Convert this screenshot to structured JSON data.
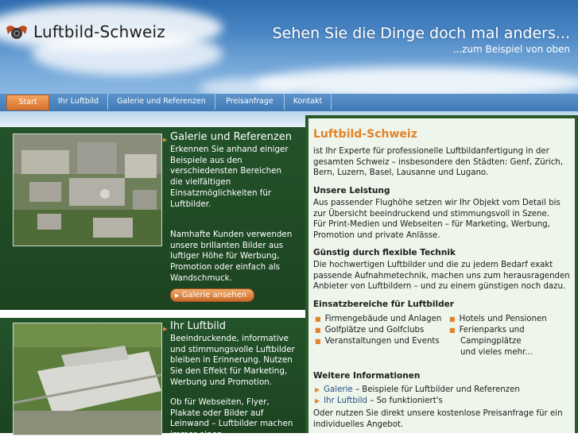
{
  "header": {
    "logo_text": "Luftbild-Schweiz",
    "slogan": "Sehen Sie die Dinge doch mal anders...",
    "subslogan": "...zum Beispiel von oben"
  },
  "nav": {
    "items": [
      {
        "label": "Start",
        "active": true
      },
      {
        "label": "Ihr Luftbild"
      },
      {
        "label": "Galerie und Referenzen"
      },
      {
        "label": "Preisanfrage"
      },
      {
        "label": "Kontakt"
      }
    ]
  },
  "promo_gallery": {
    "title": "Galerie und Referenzen",
    "text1": "Erkennen Sie anhand einiger Beispiele aus den verschiedensten Bereichen die vielfältigen Einsatzmöglichkeiten für Luftbilder.",
    "text2": "Namhafte Kunden verwenden unsere brillanten Bilder aus luftiger Höhe für Werbung, Promotion oder einfach als Wandschmuck.",
    "button": "Galerie ansehen"
  },
  "promo_luftbild": {
    "title": "Ihr Luftbild",
    "text1": "Beeindruckende, informative und stimmungsvolle Luftbilder bleiben in Erinnerung. Nutzen Sie den Effekt für Marketing, Werbung und Promotion.",
    "text2": "Ob für Webseiten, Flyer, Plakate oder Bilder auf Leinwand – Luftbilder machen immer einen"
  },
  "right": {
    "title": "Luftbild-Schweiz",
    "intro": "ist Ihr Experte für professionelle Luftbildanfertigung in der gesamten Schweiz – insbesondere den Städten: Genf, Zürich, Bern, Luzern, Basel, Lausanne und Lugano.",
    "h_leistung": "Unsere Leistung",
    "leistung": "Aus passender Flughöhe setzen wir Ihr Objekt vom Detail bis zur Übersicht beeindruckend und stimmungsvoll in Szene.",
    "leistung2": "Für Print-Medien und Webseiten – für Marketing, Werbung, Promotion und private Anlässe.",
    "h_technik": "Günstig durch flexible Technik",
    "technik": "Die hochwertigen Luftbilder und die zu jedem Bedarf exakt passende Aufnahmetechnik, machen uns zum herausragenden Anbieter von Luftbildern – und zu einem günstigen noch dazu.",
    "h_einsatz": "Einsatzbereiche für Luftbilder",
    "einsatz_left": [
      "Firmengebäude und Anlagen",
      "Golfplätze und Golfclubs",
      "Veranstaltungen und Events"
    ],
    "einsatz_right": [
      "Hotels und Pensionen",
      "Ferienparks und Campingplätze",
      "und vieles mehr..."
    ],
    "h_info": "Weitere Informationen",
    "info": [
      {
        "link": "Galerie",
        "text": "– Beispiele für Luftbilder und Referenzen"
      },
      {
        "link": "Ihr Luftbild",
        "text": "– So funktioniert's"
      }
    ],
    "closing": "Oder nutzen Sie direkt unsere kostenlose Preisanfrage für ein individuelles Angebot."
  },
  "colors": {
    "accent": "#e1832b",
    "dark_green": "#1f4a1f",
    "sky": "#4a86c4"
  }
}
